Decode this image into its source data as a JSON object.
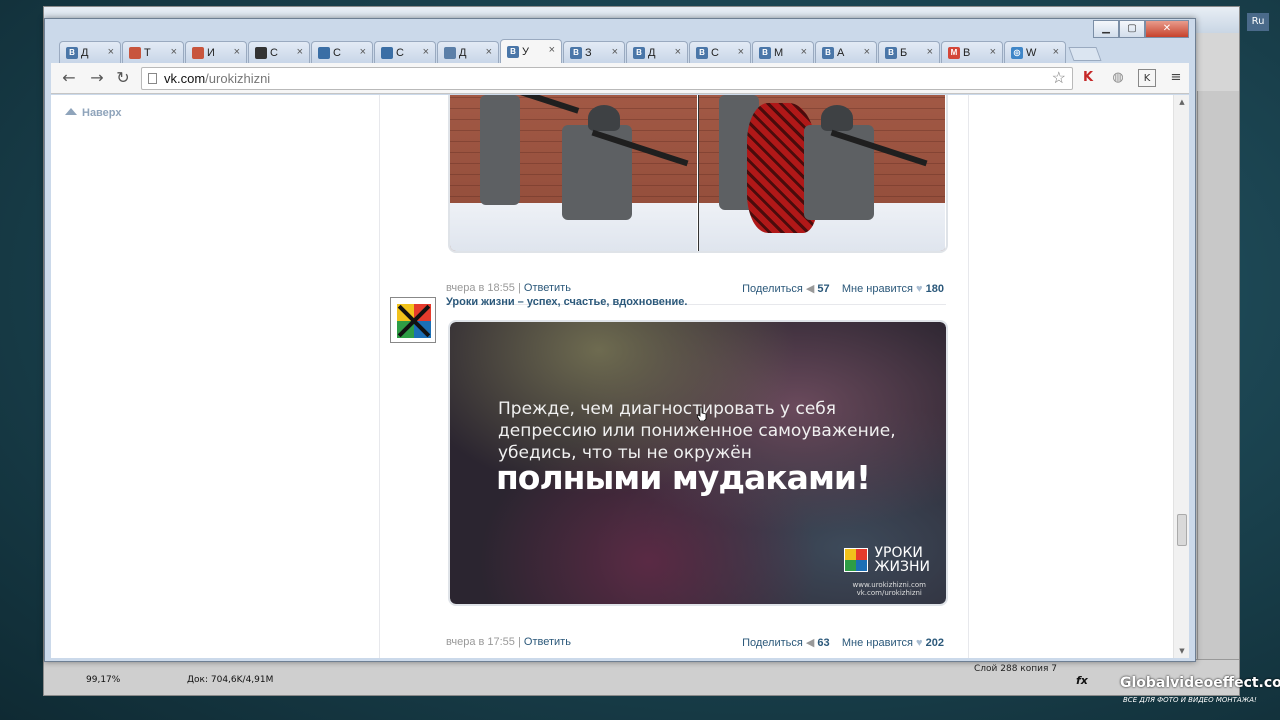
{
  "ps": {
    "zoom": "99,17%",
    "doc": "Док: 704,6K/4,91M",
    "layer": "Слой 288 копия 7",
    "lang": "Ru"
  },
  "watermark": {
    "title": "Globalvideoeffect.com",
    "subtitle": "ВСЕ ДЛЯ ФОТО И ВИДЕО МОНТАЖА!"
  },
  "tabs": [
    {
      "title": "Д",
      "icon": "vk-icon",
      "color": "#4a76a8",
      "glyph": "B"
    },
    {
      "title": "Т",
      "icon": "puzzle-icon",
      "color": "#c8553d",
      "glyph": ""
    },
    {
      "title": "И",
      "icon": "puzzle-icon",
      "color": "#c8553d",
      "glyph": ""
    },
    {
      "title": "С",
      "icon": "grid-icon",
      "color": "#333333",
      "glyph": ""
    },
    {
      "title": "С",
      "icon": "gif-icon",
      "color": "#3a6ea5",
      "glyph": ""
    },
    {
      "title": "С",
      "icon": "gif-icon",
      "color": "#3a6ea5",
      "glyph": ""
    },
    {
      "title": "Д",
      "icon": "chat-icon",
      "color": "#5b7fa8",
      "glyph": ""
    },
    {
      "title": "У",
      "icon": "vk-icon",
      "color": "#4a76a8",
      "glyph": "B",
      "active": true
    },
    {
      "title": "З",
      "icon": "vk-icon",
      "color": "#4a76a8",
      "glyph": "B"
    },
    {
      "title": "Д",
      "icon": "vk-icon",
      "color": "#4a76a8",
      "glyph": "B"
    },
    {
      "title": "С",
      "icon": "vk-icon",
      "color": "#4a76a8",
      "glyph": "B"
    },
    {
      "title": "М",
      "icon": "vk-icon",
      "color": "#4a76a8",
      "glyph": "B"
    },
    {
      "title": "А",
      "icon": "vk-icon",
      "color": "#4a76a8",
      "glyph": "B"
    },
    {
      "title": "Б",
      "icon": "vk-icon",
      "color": "#4a76a8",
      "glyph": "B"
    },
    {
      "title": "В",
      "icon": "gmail-icon",
      "color": "#d44638",
      "glyph": "M"
    },
    {
      "title": "W",
      "icon": "globe-icon",
      "color": "#3f86c8",
      "glyph": "◎"
    }
  ],
  "omnibox": {
    "domain": "vk.com",
    "path": "/urokizhizni"
  },
  "page": {
    "back_top": "Наверх",
    "post1": {
      "time": "вчера в 18:55",
      "reply": "Ответить",
      "share": "Поделиться",
      "share_count": "57",
      "like": "Мне нравится",
      "like_count": "180"
    },
    "post2": {
      "author": "Уроки жизни – успех, счастье, вдохновение.",
      "quote_line1": "Прежде, чем диагностировать у себя",
      "quote_line2": "депрессию или пониженное самоуважение,",
      "quote_line3": "убедись, что ты не окружён",
      "quote_punch": "полными мудаками!",
      "brand_line1": "УРОКИ",
      "brand_line2": "ЖИЗНИ",
      "site1": "www.urokizhizni.com",
      "site2": "vk.com/urokizhizni",
      "time": "вчера в 17:55",
      "reply": "Ответить",
      "share": "Поделиться",
      "share_count": "63",
      "like": "Мне нравится",
      "like_count": "202"
    }
  }
}
